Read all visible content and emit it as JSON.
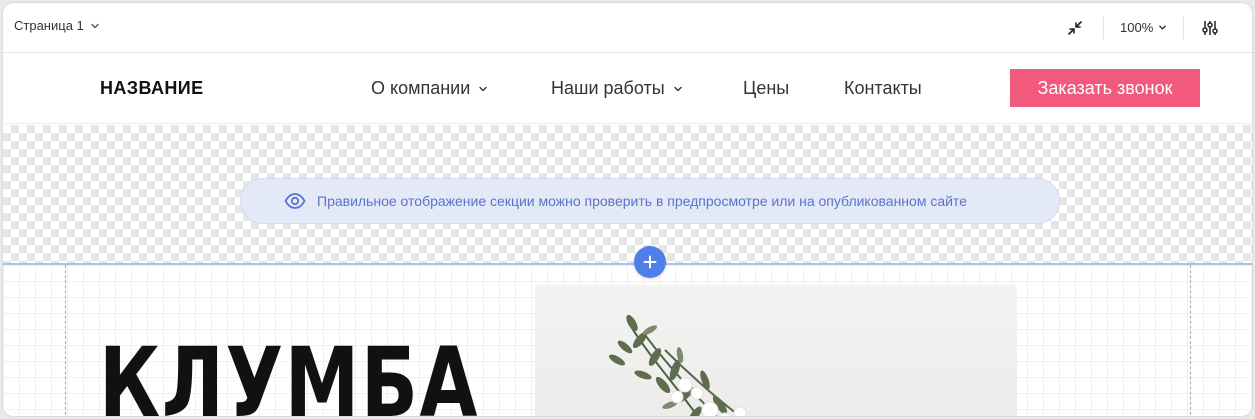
{
  "editor": {
    "page_label": "Страница 1",
    "zoom_label": "100%"
  },
  "site": {
    "logo": "НАЗВАНИЕ",
    "nav": [
      {
        "label": "О компании"
      },
      {
        "label": "Наши работы"
      },
      {
        "label": "Цены"
      },
      {
        "label": "Контакты"
      }
    ],
    "cta_label": "Заказать звонок"
  },
  "notice": {
    "text": "Правильное отображение секции можно проверить в предпросмотре или на опубликованном сайте"
  },
  "hero": {
    "title": "КЛУМБА"
  },
  "colors": {
    "cta": "#f25a7d",
    "accent": "#4f7fe8",
    "notice_bg": "#e4e9f7",
    "notice_text": "#5a74c9"
  },
  "icons": [
    "chevron-down-icon",
    "collapse-icon",
    "settings-sliders-icon",
    "eye-icon",
    "plus-icon"
  ]
}
